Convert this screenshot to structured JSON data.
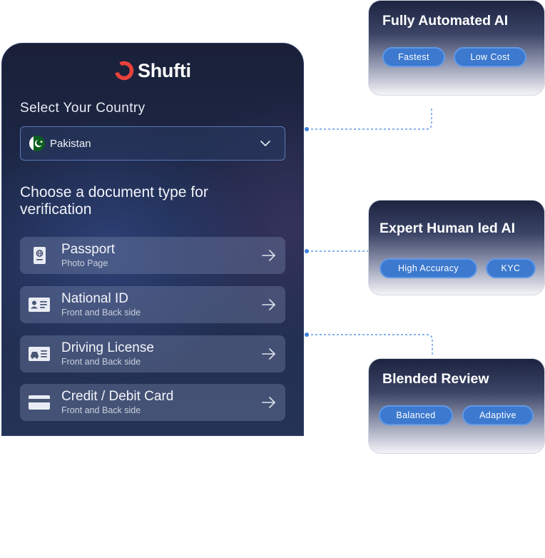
{
  "app": {
    "brand": "Shufti",
    "brand_color": "#e8423b"
  },
  "country": {
    "label": "Select Your Country",
    "selected": "Pakistan",
    "flag_icon": "pakistan-flag-icon"
  },
  "documents": {
    "heading": "Choose a document type for verification",
    "items": [
      {
        "title": "Passport",
        "subtitle": "Photo Page",
        "icon": "passport-icon"
      },
      {
        "title": "National ID",
        "subtitle": "Front and Back side",
        "icon": "id-card-icon"
      },
      {
        "title": "Driving License",
        "subtitle": "Front and Back side",
        "icon": "driving-license-icon"
      },
      {
        "title": "Credit / Debit Card",
        "subtitle": "Front and Back side",
        "icon": "credit-card-icon"
      }
    ]
  },
  "cards": [
    {
      "title": "Fully Automated AI",
      "tags": [
        "Fastest",
        "Low Cost"
      ]
    },
    {
      "title": "Expert Human led AI",
      "tags": [
        "High Accuracy",
        "KYC"
      ]
    },
    {
      "title": "Blended Review",
      "tags": [
        "Balanced",
        "Adaptive"
      ]
    }
  ],
  "colors": {
    "pill": "#3c79cf",
    "connector": "#3f82e0",
    "panel": "#1e2a4c"
  }
}
